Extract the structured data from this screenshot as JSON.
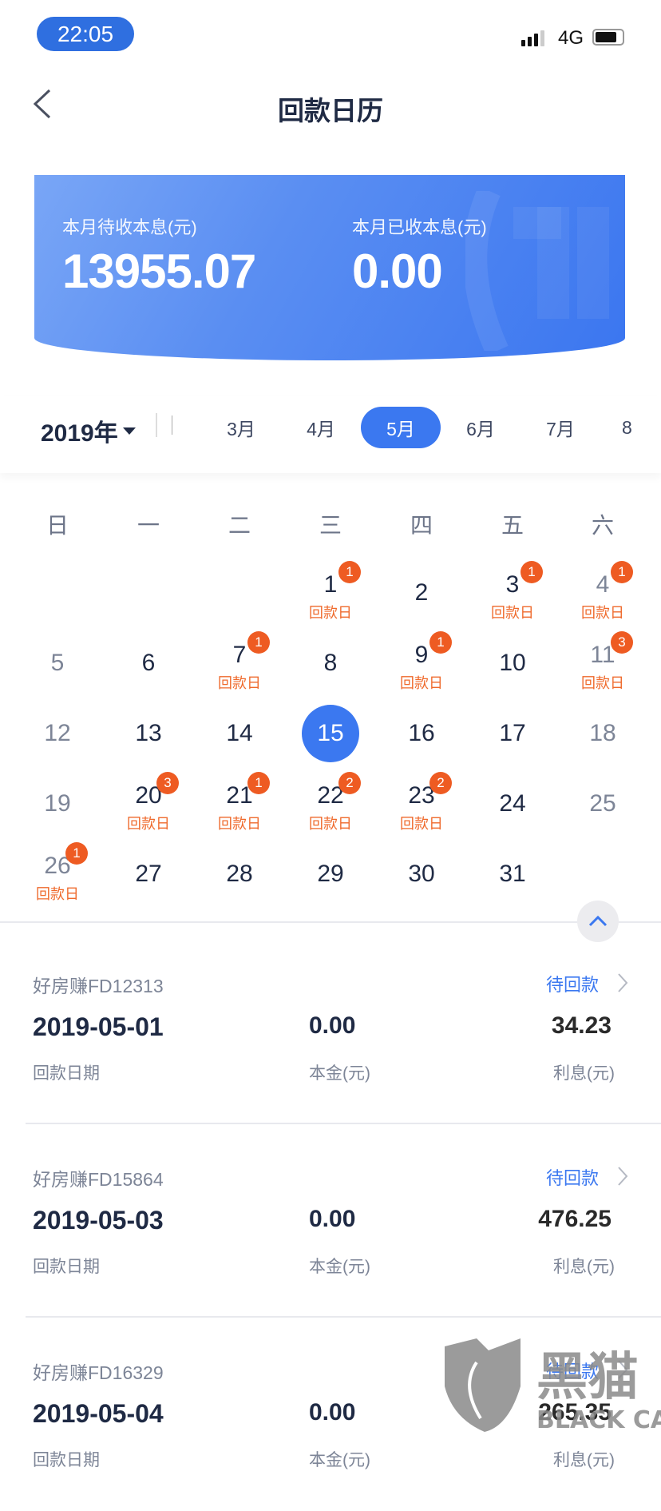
{
  "status_bar": {
    "time": "22:05",
    "network": "4G",
    "signal_bars": 3,
    "battery_level": 0.8
  },
  "header": {
    "title": "回款日历",
    "back_icon": "chevron-left-icon"
  },
  "banner": {
    "pending_label": "本月待收本息(元)",
    "pending_value": "13955.07",
    "received_label": "本月已收本息(元)",
    "received_value": "0.00"
  },
  "month_selector": {
    "year": "2019年",
    "months": [
      "3月",
      "4月",
      "5月",
      "6月",
      "7月",
      "8"
    ],
    "selected": "5月"
  },
  "calendar": {
    "weekdays": [
      "日",
      "一",
      "二",
      "三",
      "四",
      "五",
      "六"
    ],
    "first_weekday": 3,
    "days_in_month": 31,
    "today": 15,
    "tag_label": "回款日",
    "repayment_days": {
      "1": "1",
      "3": "1",
      "4": "1",
      "7": "1",
      "9": "1",
      "11": "3",
      "20": "3",
      "21": "1",
      "22": "2",
      "23": "2",
      "26": "1"
    },
    "colors": {
      "accent": "#3b78f0",
      "badge": "#ee5b22",
      "tag": "#ef6a2c"
    }
  },
  "list": {
    "labels": {
      "date": "回款日期",
      "principal": "本金(元)",
      "interest": "利息(元)"
    },
    "items": [
      {
        "name": "好房赚FD12313",
        "status": "待回款",
        "date": "2019-05-01",
        "principal": "0.00",
        "interest": "34.23"
      },
      {
        "name": "好房赚FD15864",
        "status": "待回款",
        "date": "2019-05-03",
        "principal": "0.00",
        "interest": "476.25"
      },
      {
        "name": "好房赚FD16329",
        "status": "待回款",
        "date": "2019-05-04",
        "principal": "0.00",
        "interest": "265.35"
      }
    ]
  },
  "watermark": {
    "text": "黑猫",
    "subtext": "BLACK CAT"
  }
}
